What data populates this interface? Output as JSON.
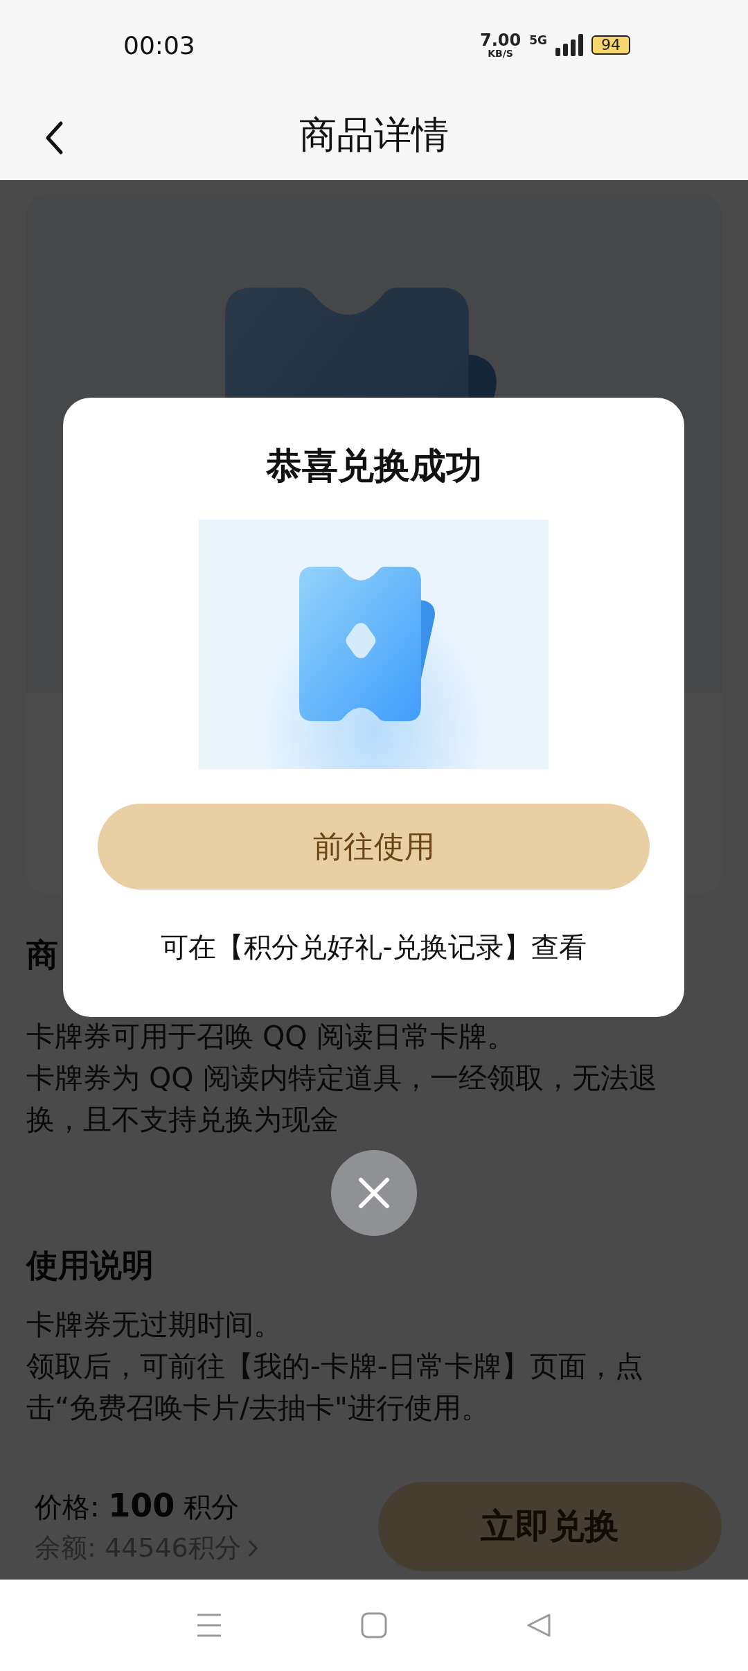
{
  "status_bar": {
    "time": "00:03",
    "net_speed": "7.00",
    "net_unit": "KB/S",
    "network": "5G",
    "battery": "94"
  },
  "header": {
    "title": "商品详情"
  },
  "product": {
    "section_title": "商",
    "description": [
      "卡牌券可用于召唤 QQ 阅读日常卡牌。",
      "卡牌券为 QQ 阅读内特定道具，一经领取，无法退换，且不支持兑换为现金"
    ]
  },
  "usage": {
    "title": "使用说明",
    "lines": [
      "卡牌券无过期时间。",
      "领取后，可前往【我的-卡牌-日常卡牌】页面，点击“免费召唤卡片/去抽卡\"进行使用。"
    ]
  },
  "purchase_bar": {
    "price": "价格: **100** 积分",
    "balance": "余额: 44546积分",
    "redeem_button": "立即兑换"
  },
  "dialog": {
    "title": "恭喜兑换成功",
    "action_button": "前往使用",
    "note": "可在【积分兑好礼-兑换记录】查看"
  }
}
